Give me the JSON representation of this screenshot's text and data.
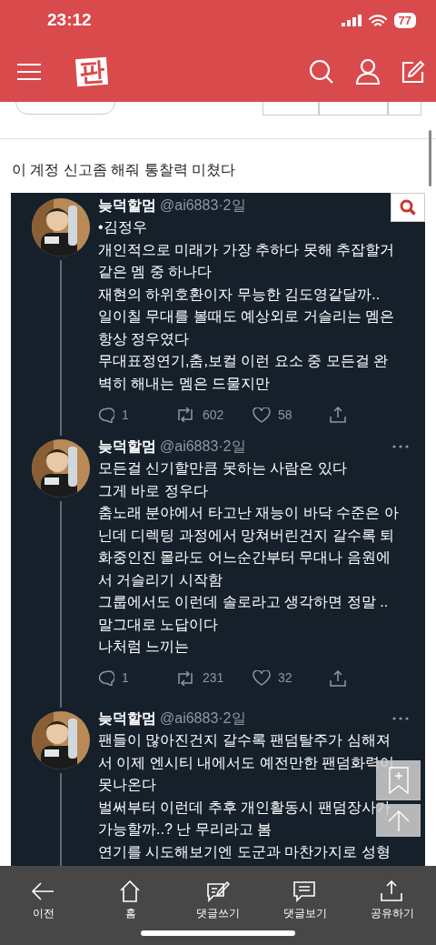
{
  "status_bar": {
    "time": "23:12",
    "battery": "77"
  },
  "header": {
    "logo": "판"
  },
  "post": {
    "title": "이 계정 신고좀 해줘 통찰력 미쳤다"
  },
  "tweets": [
    {
      "name": "늦덕할멈",
      "meta": "@ai6883·2일",
      "more_menu": false,
      "lines": [
        "•김정우",
        "개인적으로 미래가 가장 추하다 못해 추잡할거",
        "같은 멤 중 하나다",
        "재현의 하위호환이자 무능한 김도영같달까..",
        "일이칠 무대를 볼때도 예상외로 거슬리는 멤은",
        "항상 정우였다",
        "무대표정연기,춤,보컬 이런 요소 중 모든걸 완",
        "벽히 해내는 멤은 드물지만"
      ],
      "replies": "1",
      "retweets": "602",
      "likes": "58"
    },
    {
      "name": "늦덕할멈",
      "meta": "@ai6883·2일",
      "more_menu": true,
      "lines": [
        "모든걸 신기할만큼 못하는 사람은 있다",
        "그게 바로 정우다",
        "춤노래 분야에서 타고난 재능이 바닥 수준은 아",
        "닌데 디렉팅 과정에서 망쳐버린건지 갈수록 퇴",
        "화중인진 몰라도 어느순간부터 무대나 음원에",
        "서 거슬리기 시작함",
        "그룹에서도 이런데 솔로라고 생각하면 정말 ..",
        "말그대로 노답이다",
        "나처럼 느끼는"
      ],
      "replies": "1",
      "retweets": "231",
      "likes": "32"
    },
    {
      "name": "늦덕할멈",
      "meta": "@ai6883·2일",
      "more_menu": true,
      "lines": [
        "팬들이 많아진건지 갈수록 팬덤탈주가 심해져",
        "서 이제 엔시티 내에서도 예전만한 팬덤화력이",
        "못나온다",
        "벌써부터 이런데 추후 개인활동시 팬덤장사가",
        "가능할까..? 난 무리라고 봄",
        "연기를 시도해보기엔 도군과 마찬가지로 성형"
      ]
    }
  ],
  "bottom_nav": [
    {
      "kind": "back",
      "label": "이전"
    },
    {
      "kind": "home",
      "label": "홈"
    },
    {
      "kind": "write",
      "label": "댓글쓰기"
    },
    {
      "kind": "comments",
      "label": "댓글보기"
    },
    {
      "kind": "share",
      "label": "공유하기"
    }
  ]
}
